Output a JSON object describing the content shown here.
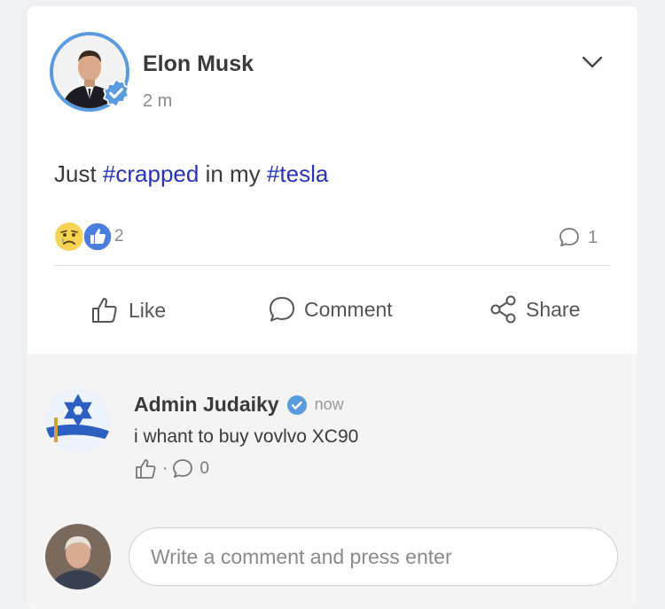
{
  "post": {
    "author": "Elon Musk",
    "time": "2 m",
    "text_parts": {
      "p1": "Just ",
      "tag1": "#crapped",
      "p2": " in my ",
      "tag2": "#tesla"
    },
    "reaction_count": "2",
    "comment_count": "1",
    "actions": {
      "like": "Like",
      "comment": "Comment",
      "share": "Share"
    }
  },
  "comment": {
    "author": "Admin Judaiky",
    "time": "now",
    "text": "i whant to buy vovlvo XC90",
    "like_separator": "·",
    "reply_count": "0"
  },
  "composer": {
    "placeholder": "Write a comment and press enter"
  },
  "colors": {
    "accent": "#5a9be0",
    "hashtag": "#2733b8",
    "like_blue": "#4a7de0"
  }
}
